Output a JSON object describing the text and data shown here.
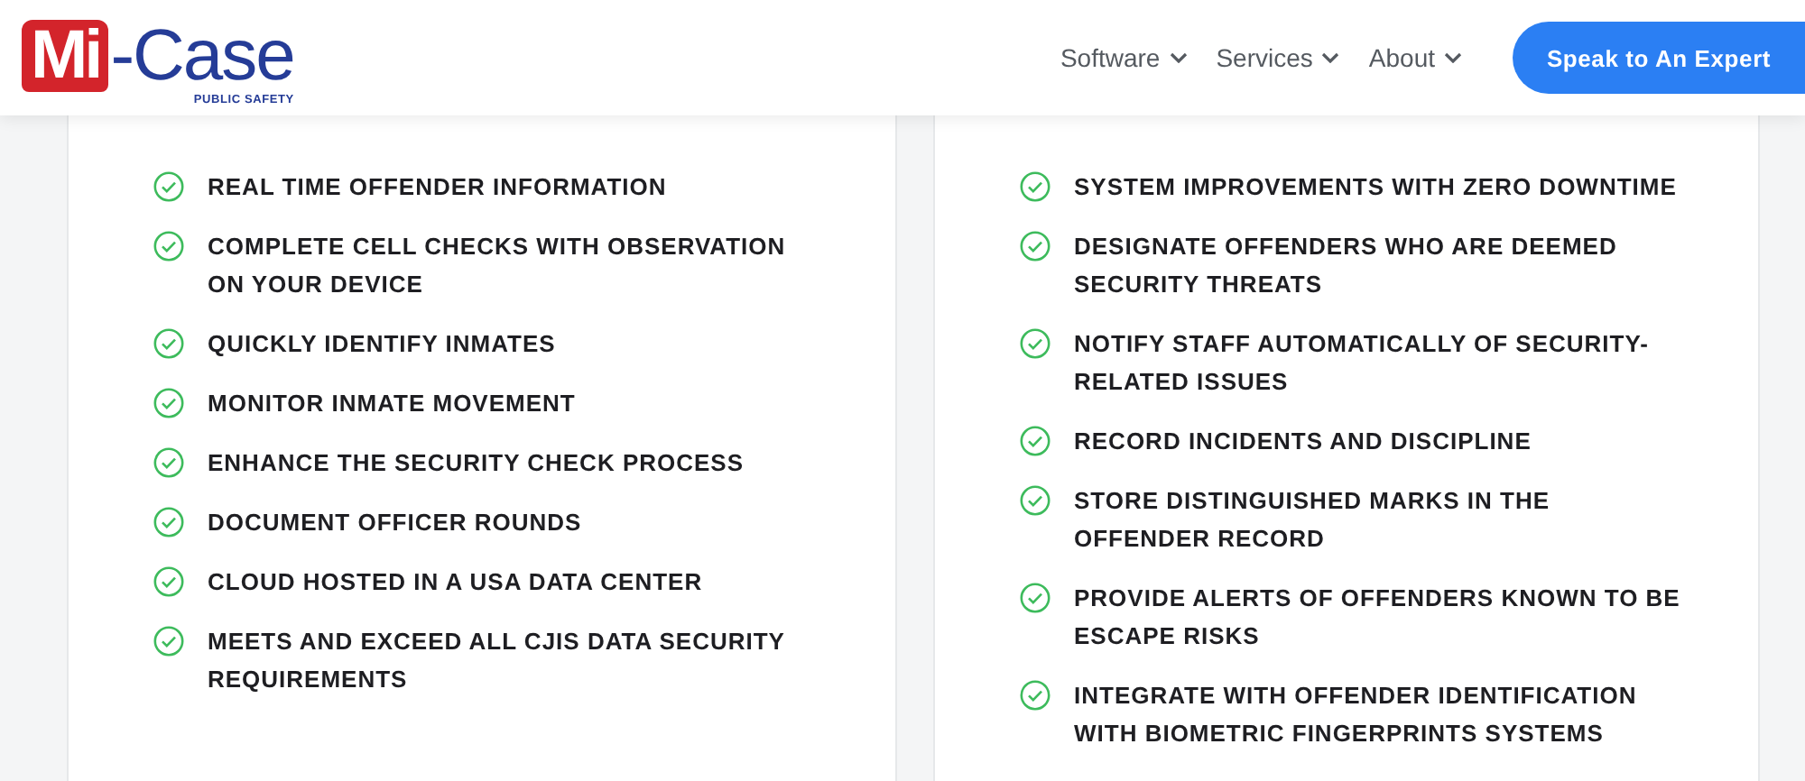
{
  "header": {
    "logo": {
      "mark": "Mi",
      "name": "-Case",
      "tagline": "PUBLIC SAFETY"
    },
    "nav": [
      {
        "label": "Software"
      },
      {
        "label": "Services"
      },
      {
        "label": "About"
      }
    ],
    "cta": "Speak to An Expert"
  },
  "features": [
    {
      "items": [
        "REAL TIME OFFENDER INFORMATION",
        "COMPLETE CELL CHECKS WITH OBSERVATION ON YOUR DEVICE",
        "QUICKLY IDENTIFY INMATES",
        "MONITOR INMATE MOVEMENT",
        "ENHANCE THE SECURITY CHECK PROCESS",
        "DOCUMENT OFFICER ROUNDS",
        "CLOUD HOSTED IN A USA DATA CENTER",
        "MEETS AND EXCEED ALL CJIS DATA SECURITY REQUIREMENTS"
      ]
    },
    {
      "items": [
        "SYSTEM IMPROVEMENTS WITH ZERO DOWNTIME",
        "DESIGNATE OFFENDERS WHO ARE DEEMED SECURITY THREATS",
        "NOTIFY STAFF AUTOMATICALLY OF SECURITY-RELATED ISSUES",
        "RECORD INCIDENTS AND DISCIPLINE",
        "STORE DISTINGUISHED MARKS IN THE OFFENDER RECORD",
        "PROVIDE ALERTS OF OFFENDERS KNOWN TO BE ESCAPE RISKS",
        "INTEGRATE WITH OFFENDER IDENTIFICATION WITH BIOMETRIC FINGERPRINTS SYSTEMS"
      ]
    }
  ]
}
